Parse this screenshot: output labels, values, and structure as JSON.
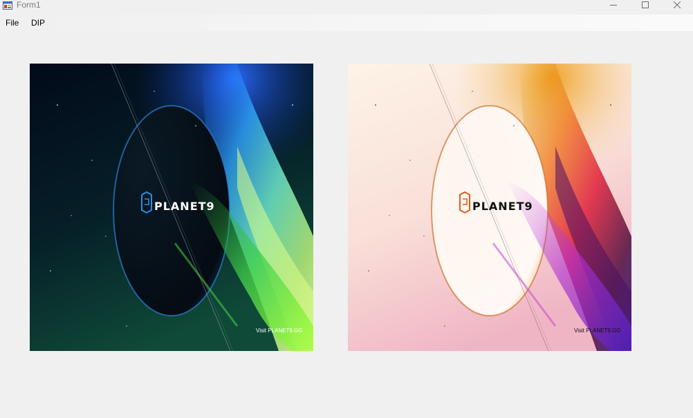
{
  "window": {
    "title": "Form1",
    "icon": "form-app-icon",
    "controls": [
      "minimize-icon",
      "maximize-icon",
      "close-icon"
    ]
  },
  "menu": {
    "items": [
      {
        "label": "File"
      },
      {
        "label": "DIP"
      }
    ]
  },
  "images": {
    "original": {
      "logo_text": "PLANET9",
      "footer_text": "Visit PLANET9.GG"
    },
    "processed": {
      "logo_text": "PLANET9",
      "footer_text": "Visit PLANET9.GG"
    }
  }
}
